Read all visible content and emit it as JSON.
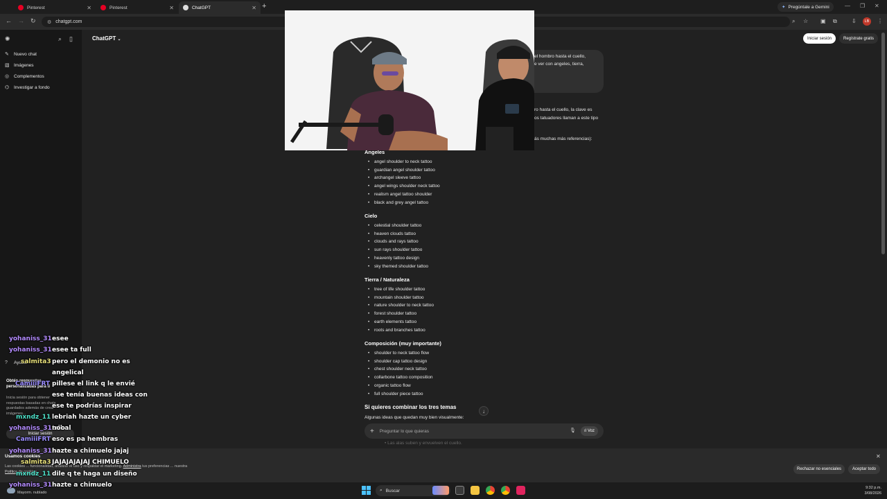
{
  "browser": {
    "tabs": [
      {
        "label": "Pinterest",
        "active": false,
        "color": "#e60023"
      },
      {
        "label": "Pinterest",
        "active": false,
        "color": "#e60023"
      },
      {
        "label": "ChatGPT",
        "active": true,
        "color": "#ffffff"
      }
    ],
    "gemini_label": "Pregúntale a Gemini",
    "url": "chatgpt.com",
    "profile_initials": "LB"
  },
  "chatgpt": {
    "model_label": "ChatGPT",
    "login_label": "Iniciar sesión",
    "signup_label": "Regístrate gratis",
    "sidebar": {
      "items": [
        {
          "label": "Nuevo chat",
          "icon": "edit-icon"
        },
        {
          "label": "Imágenes",
          "icon": "image-icon"
        },
        {
          "label": "Complementos",
          "icon": "apps-icon"
        },
        {
          "label": "Investigar a fondo",
          "icon": "telescope-icon"
        }
      ],
      "bottom_items": [
        {
          "label": "Ayuda",
          "icon": "help-icon"
        }
      ],
      "promo_title": "Obtén respuestas personalizadas para ti",
      "promo_text": "Inicia sesión para obtener respuestas basadas en chats guardados además de crear imágenes...",
      "login_label": "Iniciar sesión"
    },
    "user_message_lines": [
      "el hombro hasta el cuello,",
      "e ver con angeles, tierra,"
    ],
    "reply_fragments": [
      "ro hasta el cuello, la clave es",
      "os tatuadores llaman a este tipo",
      "ás muchas más referencias):"
    ],
    "sections": [
      {
        "title": "Ángeles",
        "items": [
          "angel shoulder to neck tattoo",
          "guardian angel shoulder tattoo",
          "archangel sleeve tattoo",
          "angel wings shoulder neck tattoo",
          "realism angel tattoo shoulder",
          "black and grey angel tattoo"
        ]
      },
      {
        "title": "Cielo",
        "items": [
          "celestial shoulder tattoo",
          "heaven clouds tattoo",
          "clouds and rays tattoo",
          "sun rays shoulder tattoo",
          "heavenly tattoo design",
          "sky themed shoulder tattoo"
        ]
      },
      {
        "title": "Tierra / Naturaleza",
        "items": [
          "tree of life shoulder tattoo",
          "mountain shoulder tattoo",
          "nature shoulder to neck tattoo",
          "forest shoulder tattoo",
          "earth elements tattoo",
          "roots and branches tattoo"
        ]
      },
      {
        "title": "Composición (muy importante)",
        "items": [
          "shoulder to neck tattoo flow",
          "shoulder cap tattoo design",
          "chest shoulder neck tattoo",
          "collarbone tattoo composition",
          "organic tattoo flow",
          "full shoulder piece tattoo"
        ]
      }
    ],
    "combine_title": "Si quieres combinar los tres temas",
    "combine_sub": "Algunas ideas que quedan muy bien visualmente:",
    "faded_line": "Las alas suben y envuelven el cuello.",
    "composer_placeholder": "Preguntar lo que quieras",
    "voice_label": "Voz"
  },
  "cookie_banner": {
    "title": "Usamos cookies",
    "text_prefix": "Las cookies ... funcionalidad, analizar el uso y respaldar el marketing.",
    "link_admin": "Administra",
    "text_middle": " tus preferencias ... nuestra ",
    "link_policy": "Política de cookies",
    "reject_label": "Rechazar no esenciales",
    "accept_label": "Aceptar todo"
  },
  "taskbar": {
    "weather": "Mayorm. nublado",
    "search_label": "Buscar",
    "time": "9:32 p.m.",
    "date": "3/08/2026"
  },
  "stream_chat": [
    {
      "user": "yohaniss_31",
      "color": "#b48cff",
      "text": "esee"
    },
    {
      "user": "yohaniss_31",
      "color": "#b48cff",
      "text": "esee ta full"
    },
    {
      "user": "salmita3",
      "color": "#e8e07a",
      "text": "pero el demonio no es angelical"
    },
    {
      "user": "CamiiiFRT",
      "color": "#9a8cff",
      "text": "pillese el link q le envié ese tenía buenas ideas con ese te podrías inspirar"
    },
    {
      "user": "mxndz_11",
      "color": "#4ee0c8",
      "text": "lebriah hazte un cyber tribal"
    },
    {
      "user": "yohaniss_31",
      "color": "#b48cff",
      "text": "noo"
    },
    {
      "user": "CamiiiFRT",
      "color": "#9a8cff",
      "text": "eso es pa hembras"
    },
    {
      "user": "yohaniss_31",
      "color": "#b48cff",
      "text": "hazte a chimuelo jajaj"
    },
    {
      "user": "salmita3",
      "color": "#e8e07a",
      "text": "JAJAJAJAJAJ CHIMUELO"
    },
    {
      "user": "mxndz_11",
      "color": "#4ee0c8",
      "text": "dile q te haga un diseño"
    },
    {
      "user": "yohaniss_31",
      "color": "#b48cff",
      "text": "hazte a chimuelo"
    }
  ]
}
